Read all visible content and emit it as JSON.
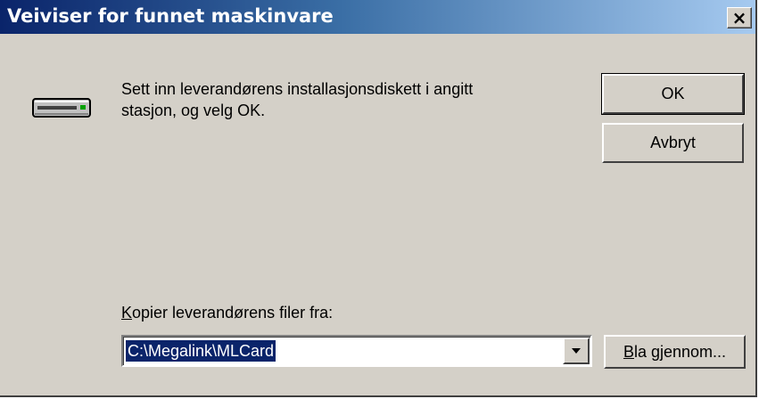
{
  "window": {
    "title": "Veiviser for funnet maskinvare",
    "close_glyph": "×",
    "icons": {
      "close": "close-icon",
      "drive": "disk-drive-icon",
      "dropdown": "chevron-down-icon"
    }
  },
  "message": {
    "line1": "Sett inn leverandørens installasjonsdiskett i angitt",
    "line2": "stasjon, og velg OK."
  },
  "buttons": {
    "ok": "OK",
    "cancel": "Avbryt",
    "browse_accel": "B",
    "browse_rest": "la gjennom..."
  },
  "copy_from": {
    "label_accel": "K",
    "label_rest": "opier leverandørens filer fra:",
    "value": "C:\\Megalink\\MLCard"
  },
  "colors": {
    "face": "#d4d0c8",
    "title_start": "#0a246a",
    "title_end": "#a6caf0",
    "selection": "#0a246a"
  }
}
